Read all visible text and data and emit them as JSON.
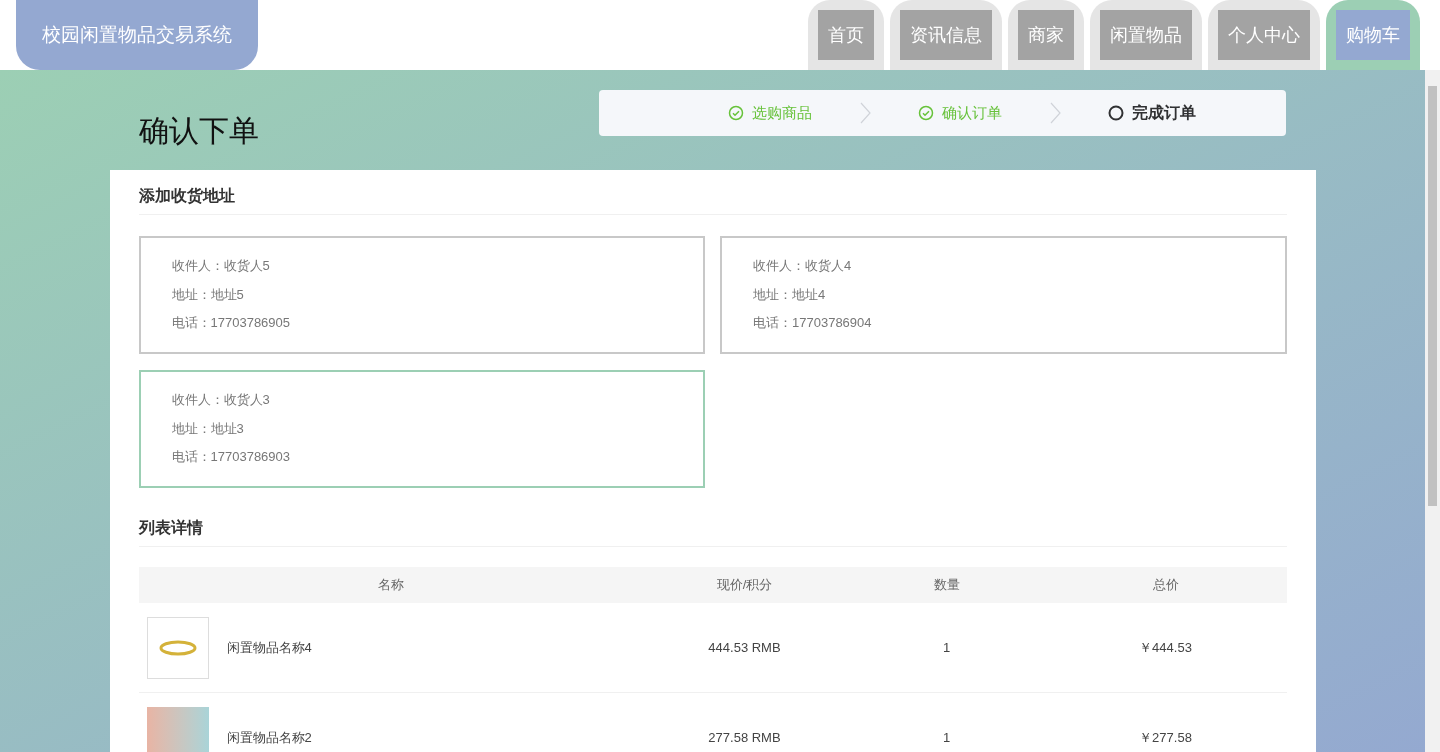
{
  "brand": "校园闲置物品交易系统",
  "nav": [
    {
      "label": "首页",
      "selected": false
    },
    {
      "label": "资讯信息",
      "selected": false
    },
    {
      "label": "商家",
      "selected": false
    },
    {
      "label": "闲置物品",
      "selected": false
    },
    {
      "label": "个人中心",
      "selected": false
    },
    {
      "label": "购物车",
      "selected": true
    }
  ],
  "page_title": "确认下单",
  "steps": [
    {
      "label": "选购商品",
      "done": true
    },
    {
      "label": "确认订单",
      "done": true
    },
    {
      "label": "完成订单",
      "done": false
    }
  ],
  "address_section": {
    "title": "添加收货地址",
    "addresses": [
      {
        "receiver": "收件人：收货人5",
        "address": "地址：地址5",
        "phone": "电话：17703786905",
        "selected": false
      },
      {
        "receiver": "收件人：收货人4",
        "address": "地址：地址4",
        "phone": "电话：17703786904",
        "selected": false
      },
      {
        "receiver": "收件人：收货人3",
        "address": "地址：地址3",
        "phone": "电话：17703786903",
        "selected": true
      }
    ]
  },
  "list_section": {
    "title": "列表详情",
    "columns": [
      "名称",
      "现价/积分",
      "数量",
      "总价"
    ],
    "rows": [
      {
        "kind": "ring",
        "name": "闲置物品名称4",
        "price": "444.53 RMB",
        "quantity": "1",
        "total": "￥444.53"
      },
      {
        "kind": "photo",
        "name": "闲置物品名称2",
        "price": "277.58 RMB",
        "quantity": "1",
        "total": "￥277.58"
      }
    ]
  }
}
